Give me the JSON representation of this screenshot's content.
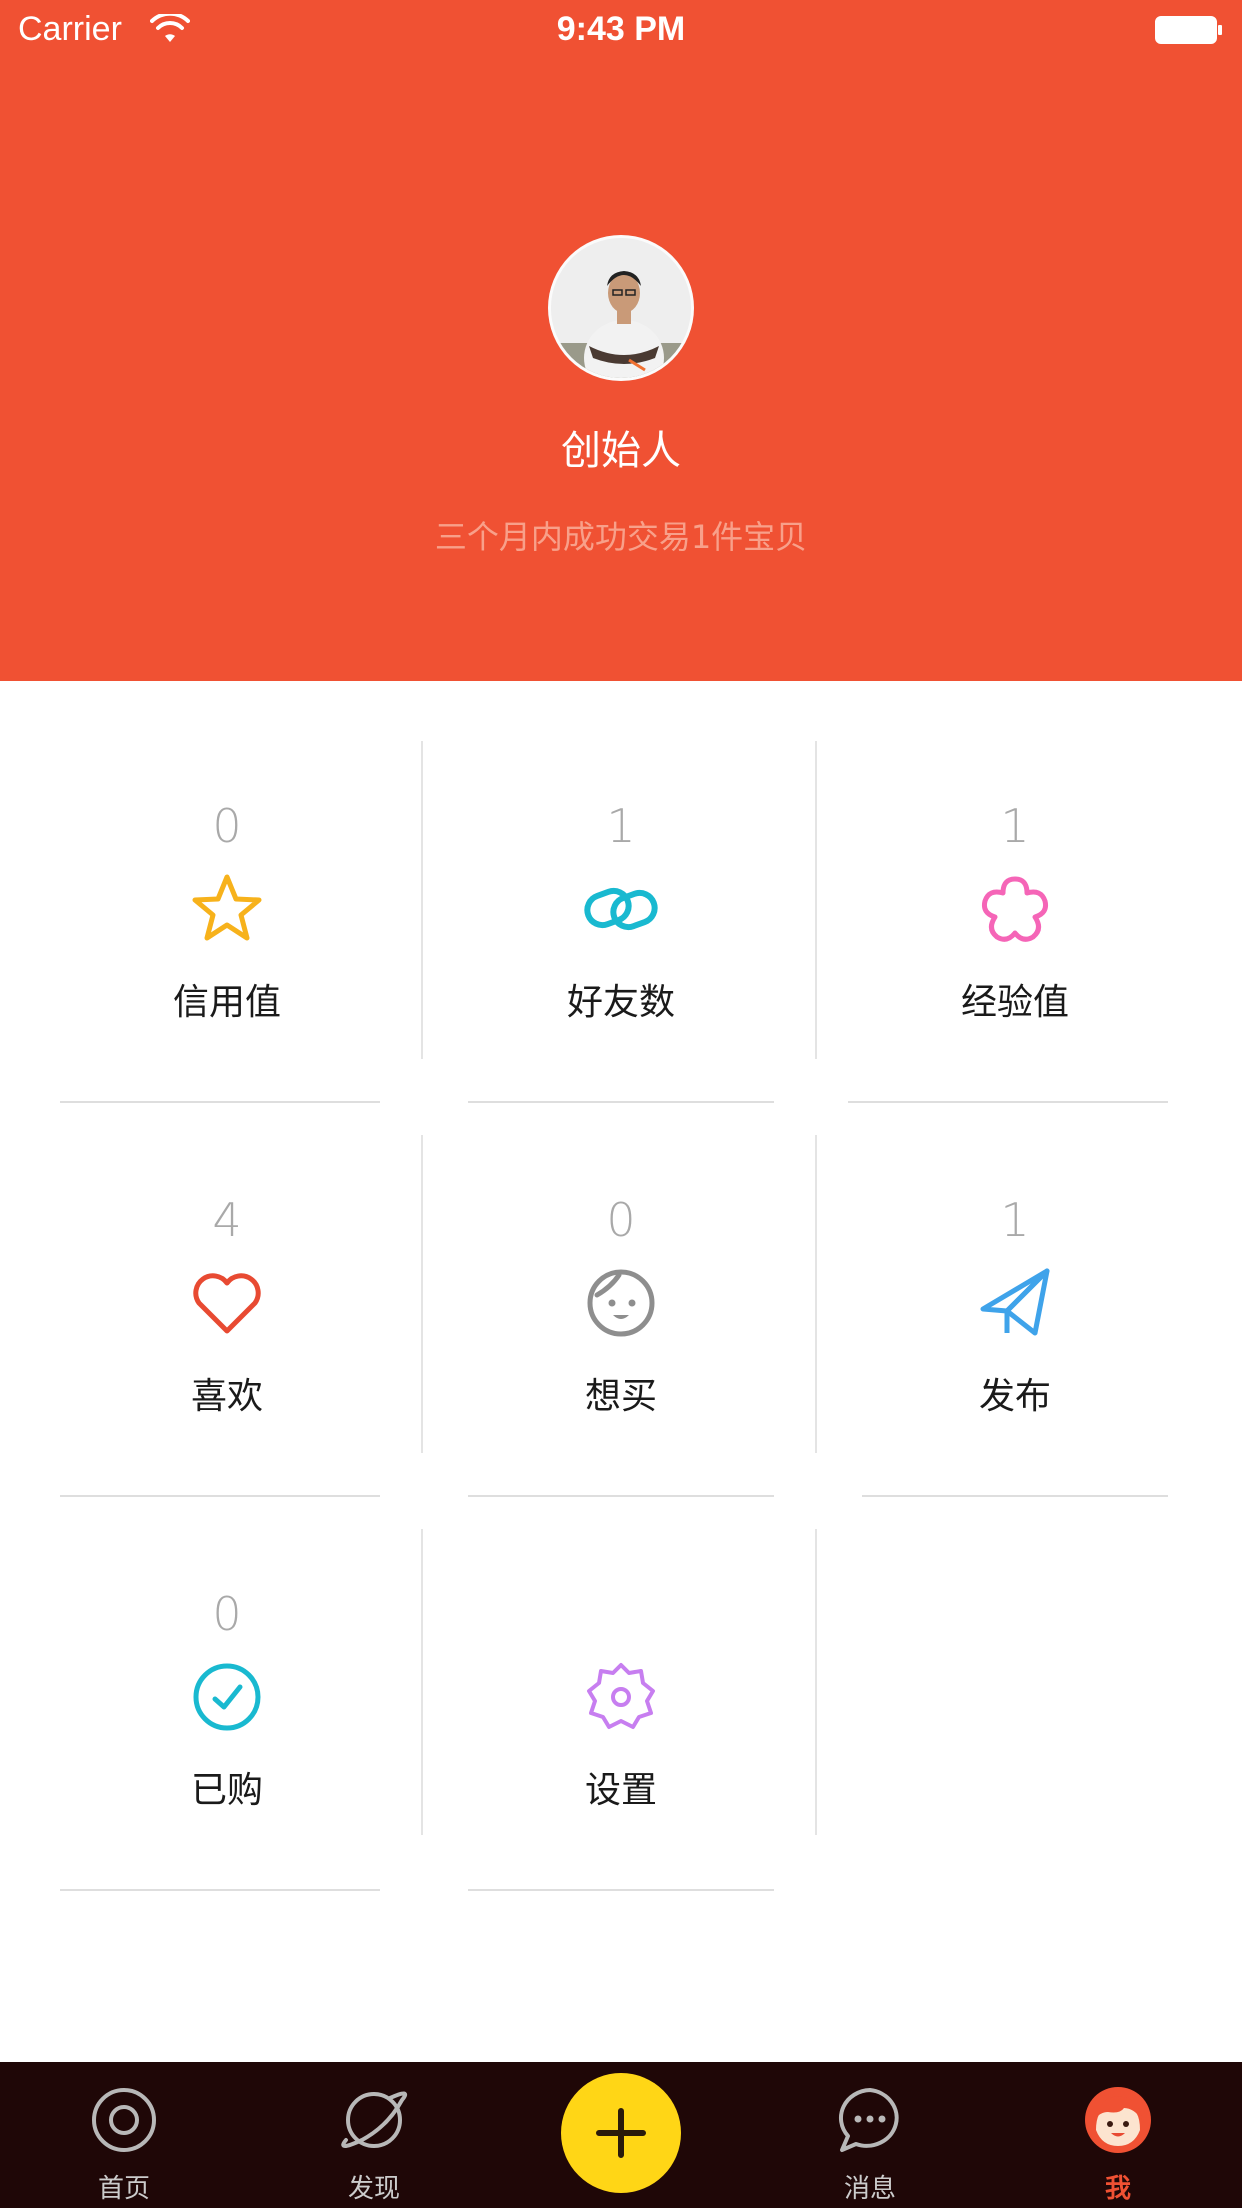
{
  "status_bar": {
    "carrier": "Carrier",
    "time": "9:43 PM"
  },
  "profile": {
    "name": "创始人",
    "subtitle": "三个月内成功交易1件宝贝"
  },
  "stats": [
    {
      "value": "0",
      "label": "信用值",
      "icon": "star-icon",
      "color": "#f7b21b"
    },
    {
      "value": "1",
      "label": "好友数",
      "icon": "link-rings-icon",
      "color": "#19b9d0"
    },
    {
      "value": "1",
      "label": "经验值",
      "icon": "flower-icon",
      "color": "#f565b7"
    },
    {
      "value": "4",
      "label": "喜欢",
      "icon": "heart-icon",
      "color": "#e84a32"
    },
    {
      "value": "0",
      "label": "想买",
      "icon": "face-icon",
      "color": "#8e8e8e"
    },
    {
      "value": "1",
      "label": "发布",
      "icon": "paper-plane-icon",
      "color": "#3fa3ea"
    },
    {
      "value": "0",
      "label": "已购",
      "icon": "check-circle-icon",
      "color": "#19b9d0"
    },
    {
      "value": "",
      "label": "设置",
      "icon": "gear-icon",
      "color": "#c77ef0"
    }
  ],
  "tabbar": {
    "tabs": [
      {
        "label": "首页",
        "icon": "home-target-icon"
      },
      {
        "label": "发现",
        "icon": "planet-icon"
      },
      {
        "label": "消息",
        "icon": "chat-bubble-icon"
      },
      {
        "label": "我",
        "icon": "me-face-icon"
      }
    ],
    "add_button_icon": "plus-icon",
    "active_tab": "我",
    "colors": {
      "background": "#1f0707",
      "active": "#f05133",
      "add_button": "#ffd616"
    }
  },
  "theme": {
    "header": "#f05133"
  }
}
